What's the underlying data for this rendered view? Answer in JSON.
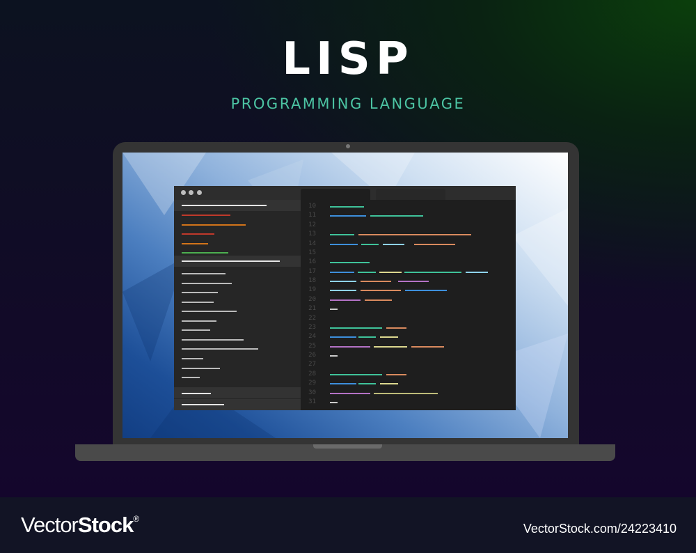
{
  "title": "LISP",
  "subtitle": "PROGRAMMING LANGUAGE",
  "editor": {
    "line_numbers": [
      "10",
      "11",
      "12",
      "13",
      "14",
      "15",
      "16",
      "17",
      "18",
      "19",
      "20",
      "21",
      "22",
      "23",
      "24",
      "25",
      "26",
      "27",
      "28",
      "29",
      "30",
      "31"
    ],
    "window_controls": [
      "dot-icon",
      "dot-icon",
      "dot-icon"
    ]
  },
  "colors": {
    "accent": "#4cc4a3",
    "code_green": "#3fc39a",
    "code_blue": "#3d8fdc",
    "code_orange": "#d98a5e",
    "code_lightblue": "#8fd3f4",
    "code_yellow": "#dcd88f",
    "code_purple": "#b472c6",
    "sidebar_red": "#c0392b",
    "sidebar_orange": "#d2741a",
    "sidebar_green": "#4caf50"
  },
  "watermark": {
    "brand_light": "Vector",
    "brand_bold": "Stock",
    "registered": "®",
    "id": "VectorStock.com/24223410"
  }
}
